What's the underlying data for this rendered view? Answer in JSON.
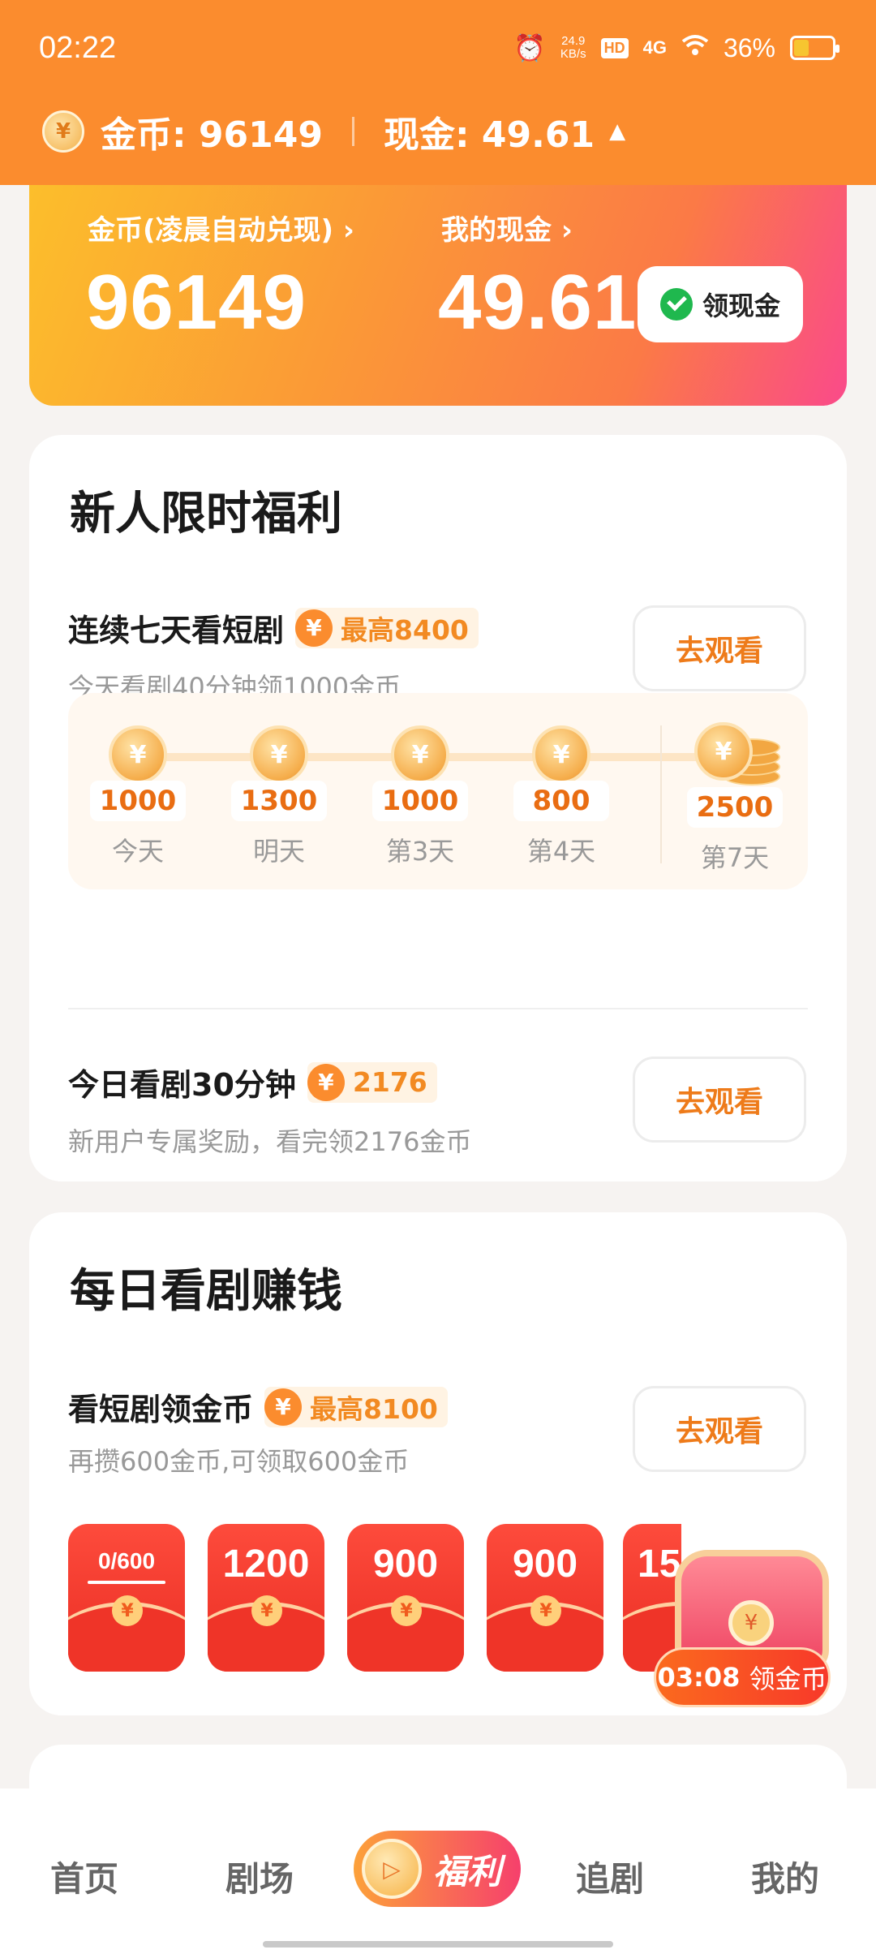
{
  "status": {
    "time": "02:22",
    "net_speed_value": "24.9",
    "net_speed_unit": "KB/s",
    "hd": "HD",
    "signal": "4G",
    "battery": "36%"
  },
  "topbar": {
    "coins_label": "金币: 96149",
    "cash_label": "现金: 49.61"
  },
  "hero": {
    "coins_title": "金币(凌晨自动兑现) ›",
    "coins_value": "96149",
    "cash_title": "我的现金 ›",
    "cash_value": "49.61",
    "withdraw_button": "领现金"
  },
  "newbie": {
    "title": "新人限时福利",
    "task1": {
      "title": "连续七天看短剧",
      "badge": "最高8400",
      "sub": "今天看剧40分钟领1000金币",
      "button": "去观看"
    },
    "streak": [
      {
        "amount": "1000",
        "label": "今天"
      },
      {
        "amount": "1300",
        "label": "明天"
      },
      {
        "amount": "1000",
        "label": "第3天"
      },
      {
        "amount": "800",
        "label": "第4天"
      },
      {
        "amount": "2500",
        "label": "第7天"
      }
    ],
    "task2": {
      "title": "今日看剧30分钟",
      "badge": "2176",
      "sub": "新用户专属奖励，看完领2176金币",
      "button": "去观看"
    }
  },
  "daily": {
    "title": "每日看剧赚钱",
    "task": {
      "title": "看短剧领金币",
      "badge": "最高8100",
      "sub": "再攒600金币,可领取600金币",
      "button": "去观看"
    },
    "envelopes": [
      {
        "top": "0/600",
        "progress": 0
      },
      {
        "top": "1200"
      },
      {
        "top": "900"
      },
      {
        "top": "900"
      },
      {
        "top": "15"
      }
    ]
  },
  "chest": {
    "timer": "03:08",
    "label": "领金币"
  },
  "nav": {
    "home": "首页",
    "theater": "剧场",
    "welfare": "福利",
    "follow": "追剧",
    "mine": "我的"
  },
  "glyphs": {
    "yen": "¥",
    "arrow_up": "▲"
  },
  "colors": {
    "brand_orange": "#fb8c2e",
    "accent_text": "#ee7b1a",
    "envelope_red": "#f03a2c"
  }
}
